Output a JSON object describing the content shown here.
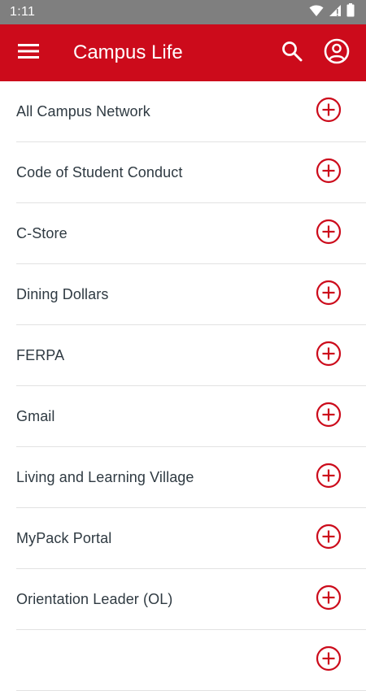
{
  "status_bar": {
    "time": "1:11",
    "icons": [
      "wifi-icon",
      "signal-icon",
      "battery-icon"
    ]
  },
  "header": {
    "title": "Campus Life",
    "background_color": "#cc0b1b",
    "icons": [
      "menu-icon",
      "search-icon",
      "account-icon"
    ]
  },
  "accent_color": "#cc0b1b",
  "list": {
    "items": [
      {
        "label": "All Campus Network"
      },
      {
        "label": "Code of Student Conduct"
      },
      {
        "label": "C-Store"
      },
      {
        "label": "Dining Dollars"
      },
      {
        "label": "FERPA"
      },
      {
        "label": "Gmail"
      },
      {
        "label": "Living and Learning Village"
      },
      {
        "label": "MyPack Portal"
      },
      {
        "label": "Orientation Leader (OL)"
      },
      {
        "label": ""
      }
    ],
    "item_action_icon": "add-circle-icon"
  }
}
